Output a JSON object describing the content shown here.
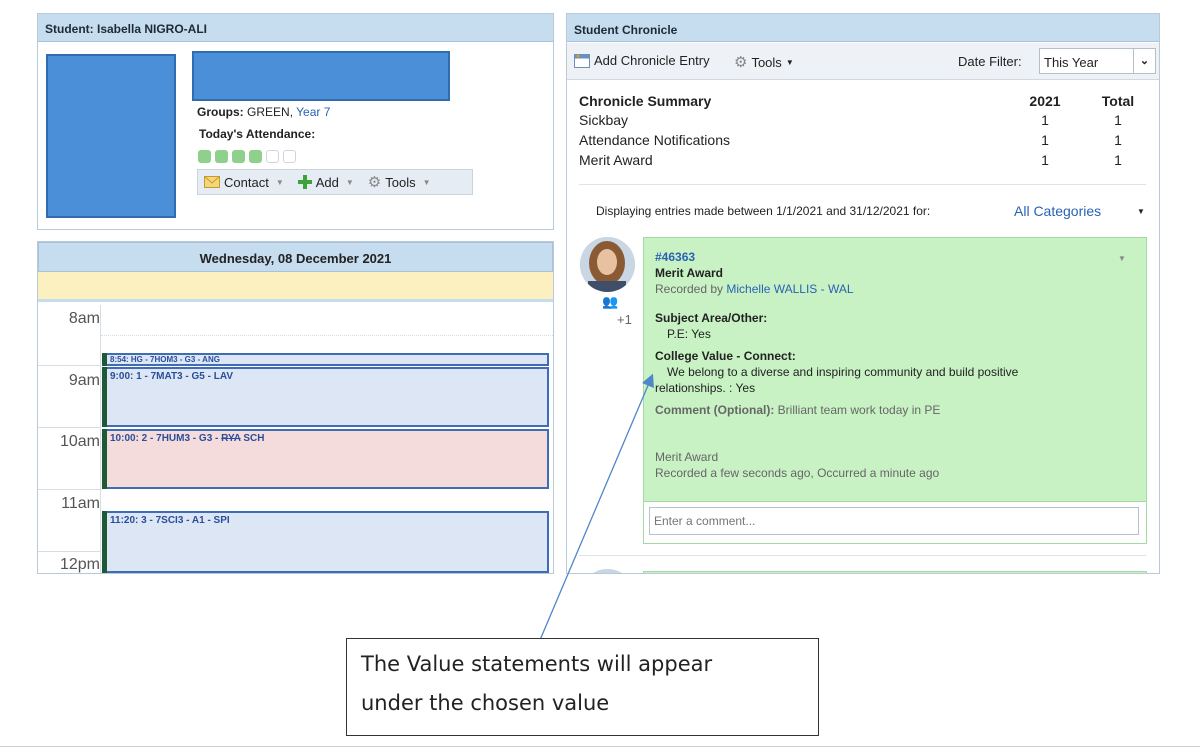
{
  "student_panel": {
    "title": "Student: Isabella NIGRO-ALI",
    "groups_label": "Groups:",
    "groups_value": "GREEN,",
    "groups_link": "Year 7",
    "attendance_label": "Today's Attendance:",
    "attendance": [
      true,
      true,
      true,
      true,
      false,
      false
    ],
    "toolbar": {
      "contact": "Contact",
      "add": "Add",
      "tools": "Tools"
    }
  },
  "calendar": {
    "date": "Wednesday, 08 December 2021",
    "hours": [
      "8am",
      "9am",
      "10am",
      "11am",
      "12pm"
    ],
    "events": [
      "8:54: HG - 7HOM3 - G3 - ANG",
      "9:00: 1 - 7MAT3 - G5 - LAV",
      {
        "prefix": "10:00: 2 - 7HUM3 - G3 - ",
        "struck": "RYA",
        "suffix": " SCH"
      },
      "11:20: 3 - 7SCI3 - A1 - SPI"
    ]
  },
  "chronicle": {
    "title": "Student Chronicle",
    "add_entry": "Add Chronicle Entry",
    "tools": "Tools",
    "date_filter_label": "Date Filter:",
    "date_filter_value": "This Year",
    "summary": {
      "heading": "Chronicle Summary",
      "col_year": "2021",
      "col_total": "Total",
      "rows": [
        {
          "label": "Sickbay",
          "year": "1",
          "total": "1"
        },
        {
          "label": "Attendance Notifications",
          "year": "1",
          "total": "1"
        },
        {
          "label": "Merit Award",
          "year": "1",
          "total": "1"
        }
      ]
    },
    "display_text": "Displaying entries made between 1/1/2021 and 31/12/2021 for:",
    "category_filter": "All Categories",
    "entry": {
      "id": "#46363",
      "type": "Merit Award",
      "recorded_by_label": "Recorded by",
      "recorded_by": "Michelle WALLIS - WAL",
      "plus_count": "+1",
      "subject_label": "Subject Area/Other:",
      "subject_value": "P.E: Yes",
      "value_label": "College Value - Connect:",
      "value_text_1": "We belong to a diverse and inspiring community and build positive",
      "value_text_2": "relationships. : Yes",
      "comment_label": "Comment (Optional):",
      "comment_value": "Brilliant team work today in PE",
      "footer_type": "Merit Award",
      "footer_time": "Recorded a few seconds ago, Occurred a minute ago",
      "comment_placeholder": "Enter a comment..."
    }
  },
  "callout": {
    "line1": "The Value statements will appear",
    "line2": "under the chosen value"
  }
}
